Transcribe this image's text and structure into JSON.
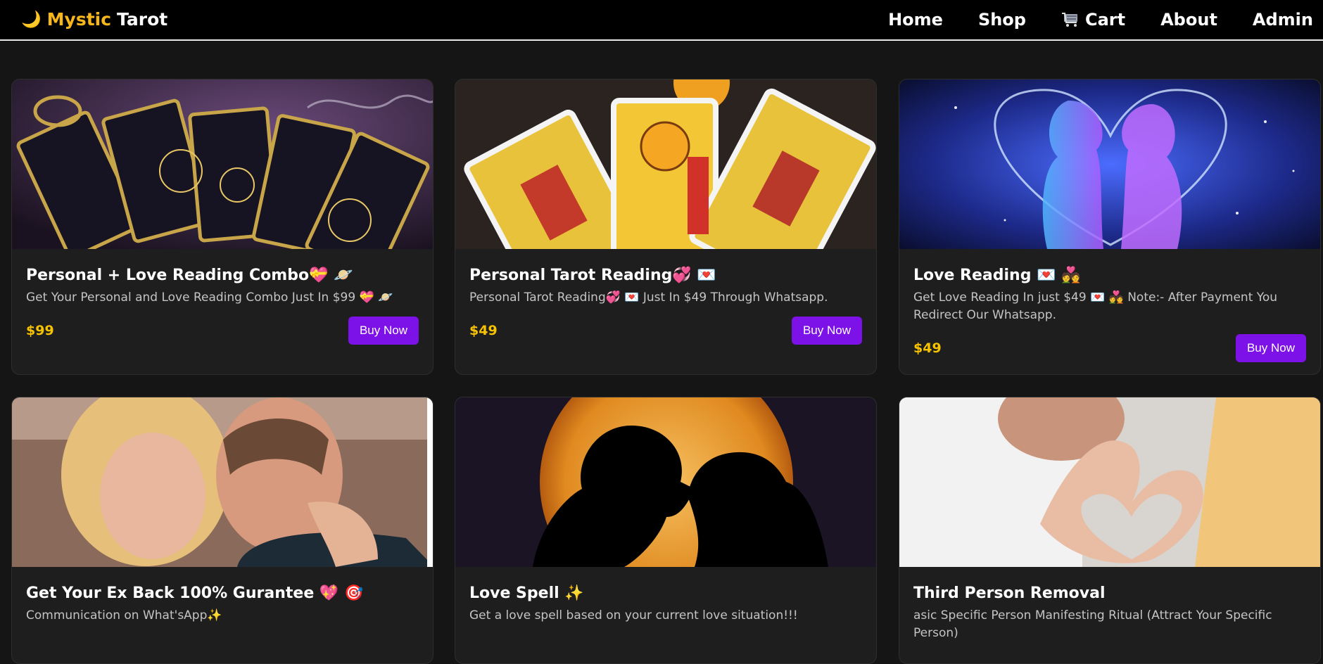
{
  "nav": {
    "brand_moon": "🌙",
    "brand_part1": "Mystic",
    "brand_part2": "Tarot",
    "links": {
      "home": "Home",
      "shop": "Shop",
      "cart": "Cart",
      "about": "About",
      "admin": "Admin"
    }
  },
  "colors": {
    "accent_gold": "#f7b71b",
    "price_gold": "#f7c300",
    "button_purple": "#7d12e8",
    "card_bg": "#1e1e1e",
    "page_bg": "#151515"
  },
  "products": [
    {
      "title": "Personal + Love Reading Combo💝 🪐",
      "desc": "Get Your Personal and Love Reading Combo Just In $99 💝 🪐",
      "price": "$99",
      "button": "Buy Now",
      "image": "tarot-cards-gold-image"
    },
    {
      "title": "Personal Tarot Reading💞 💌",
      "desc": "Personal Tarot Reading💞 💌 Just In $49 Through Whatsapp.",
      "price": "$49",
      "button": "Buy Now",
      "image": "rider-waite-tarot-image"
    },
    {
      "title": "Love Reading 💌 💑",
      "desc": "Get Love Reading In just $49 💌 💑 Note:- After Payment You Redirect Our Whatsapp.",
      "price": "$49",
      "button": "Buy Now",
      "image": "cosmic-couple-image"
    },
    {
      "title": "Get Your Ex Back 100% Gurantee 💖 🎯",
      "desc": "Communication on What'sApp✨",
      "image": "kissing-couple-image"
    },
    {
      "title": "Love Spell ✨",
      "desc": "Get a love spell based on your current love situation!!!",
      "image": "moon-silhouette-couple-image"
    },
    {
      "title": "Third Person Removal",
      "desc": "asic Specific Person Manifesting Ritual (Attract Your Specific Person)",
      "image": "heart-hands-couple-image"
    }
  ]
}
